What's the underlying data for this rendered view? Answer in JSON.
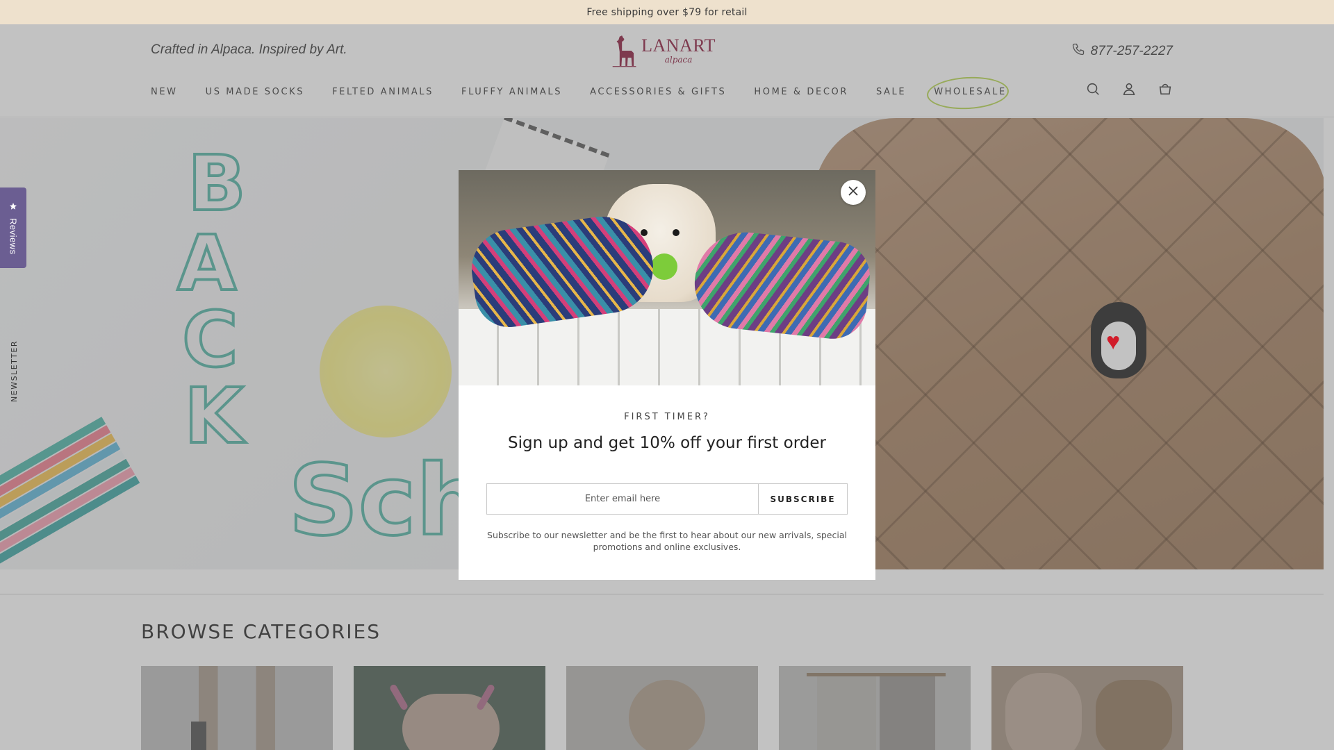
{
  "announcement": "Free shipping over $79 for retail",
  "header": {
    "tagline": "Crafted in Alpaca. Inspired by Art.",
    "logo": {
      "brand": "LANART",
      "sub": "alpaca"
    },
    "phone": "877-257-2227"
  },
  "nav": {
    "items": [
      "NEW",
      "US MADE SOCKS",
      "FELTED ANIMALS",
      "FLUFFY ANIMALS",
      "ACCESSORIES & GIFTS",
      "HOME & DECOR",
      "SALE",
      "WHOLESALE"
    ]
  },
  "icons": {
    "search": "search-icon",
    "account": "account-icon",
    "cart": "cart-icon",
    "phone": "phone-icon",
    "close": "close-icon",
    "star": "star-icon"
  },
  "side_tabs": {
    "reviews": "Reviews",
    "newsletter": "NEWSLETTER"
  },
  "browse": {
    "title": "BROWSE CATEGORIES"
  },
  "popup": {
    "eyebrow": "FIRST TIMER?",
    "headline": "Sign up and get 10% off your first order",
    "email_placeholder": "Enter email here",
    "subscribe_label": "SUBSCRIBE",
    "fineprint": "Subscribe to our newsletter and be the first to hear about our new arrivals, special promotions and online exclusives."
  },
  "colors": {
    "announcement_bg": "#eee1cd",
    "brand": "#8a1538",
    "reviews_tab": "#6b5e92",
    "wholesale_circle": "#b5d64a"
  }
}
